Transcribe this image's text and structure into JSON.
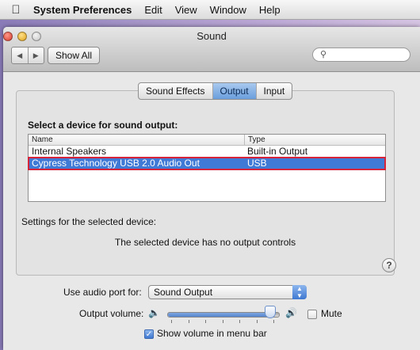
{
  "menubar": {
    "app_name": "System Preferences",
    "items": [
      "Edit",
      "View",
      "Window",
      "Help"
    ]
  },
  "window": {
    "title": "Sound",
    "show_all": "Show All",
    "search_placeholder": ""
  },
  "tabs": [
    {
      "label": "Sound Effects",
      "active": false
    },
    {
      "label": "Output",
      "active": true
    },
    {
      "label": "Input",
      "active": false
    }
  ],
  "output": {
    "select_label": "Select a device for sound output:",
    "columns": [
      "Name",
      "Type"
    ],
    "devices": [
      {
        "name": "Internal Speakers",
        "type": "Built-in Output",
        "selected": false
      },
      {
        "name": "Cypress Technology USB 2.0 Audio Out",
        "type": "USB",
        "selected": true
      }
    ],
    "settings_label": "Settings for the selected device:",
    "no_controls": "The selected device has no output controls",
    "help": "?"
  },
  "bottom": {
    "audio_port_label": "Use audio port for:",
    "audio_port_value": "Sound Output",
    "volume_label": "Output volume:",
    "volume_level": 0.93,
    "mute_label": "Mute",
    "mute_checked": false,
    "show_volume_label": "Show volume in menu bar",
    "show_volume_checked": true
  }
}
